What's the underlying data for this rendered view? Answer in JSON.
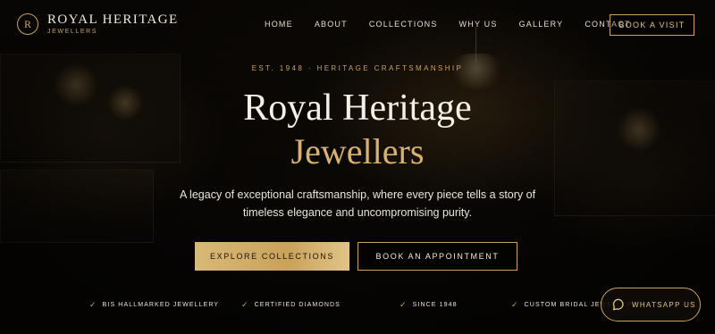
{
  "brand": {
    "badge": "R",
    "name": "ROYAL HERITAGE",
    "sub": "JEWELLERS"
  },
  "nav": {
    "links": [
      "HOME",
      "ABOUT",
      "COLLECTIONS",
      "WHY US",
      "GALLERY",
      "CONTACT"
    ],
    "cta": "BOOK A VISIT"
  },
  "hero": {
    "eyebrow": "EST. 1948 · HERITAGE CRAFTSMANSHIP",
    "title_line1": "Royal Heritage",
    "title_line2": "Jewellers",
    "subtitle": "A legacy of exceptional craftsmanship, where every piece tells a story of timeless elegance and uncompromising purity.",
    "primary_button": "EXPLORE COLLECTIONS",
    "secondary_button": "BOOK AN APPOINTMENT"
  },
  "features": [
    "BIS HALLMARKED JEWELLERY",
    "CERTIFIED DIAMONDS",
    "SINCE 1948",
    "CUSTOM BRIDAL JEWELLERY"
  ],
  "whatsapp": {
    "label": "WHATSAPP US",
    "icon": "chat-bubble-icon"
  },
  "colors": {
    "gold": "#c9a35c",
    "gold_light": "#d8b26a",
    "background": "#0b0906",
    "text": "#f5efe4"
  }
}
